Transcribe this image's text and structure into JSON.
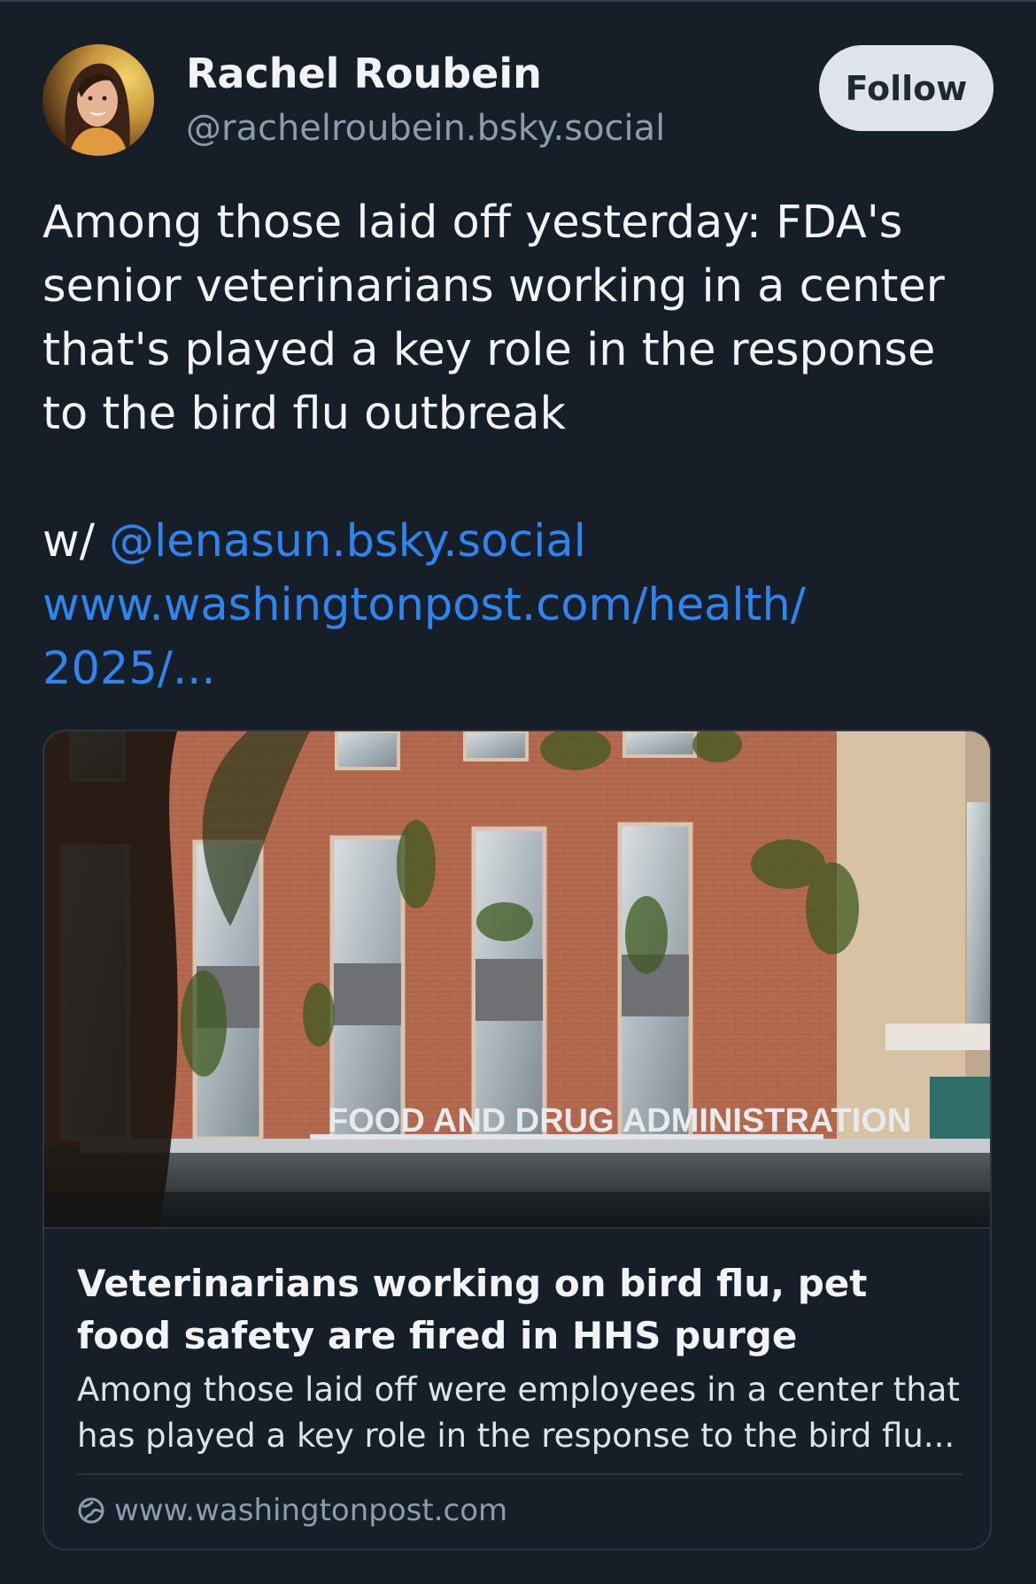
{
  "author": {
    "name": "Rachel Roubein",
    "handle": "@rachelroubein.bsky.social",
    "follow_label": "Follow"
  },
  "post": {
    "lines": [
      "Among those laid off yesterday: FDA's",
      "senior veterinarians working in a center",
      "that's played a key role in the response",
      "to the bird flu outbreak"
    ],
    "with_prefix": "w/ ",
    "mention": "@lenasun.bsky.social",
    "link_line1": "www.washingtonpost.com/health/",
    "link_line2": "2025/..."
  },
  "card": {
    "image_sign_text": "FOOD AND DRUG ADMINISTRATION",
    "title": "Veterinarians working on bird flu, pet food safety are fired in HHS purge",
    "description": "Among those laid off were employees in a center that has played a key role in the response to the bird flu...",
    "domain": "www.washingtonpost.com",
    "domain_icon": "globe-icon"
  },
  "colors": {
    "background": "#161e27",
    "link": "#2d85f0",
    "follow_button": "#dfe4ea",
    "muted_text": "#8d9cab"
  }
}
